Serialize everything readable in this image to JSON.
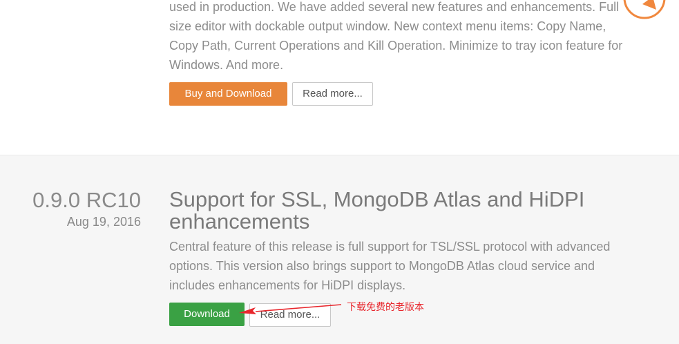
{
  "releases": [
    {
      "description": "used in production. We have added several new features and enhancements. Full size editor with dockable output window. New context menu items: Copy Name, Copy Path, Current Operations and Kill Operation. Minimize to tray icon feature for Windows. And more.",
      "primary_button": "Buy and Download",
      "secondary_button": "Read more..."
    },
    {
      "version": "0.9.0 RC10",
      "date": "Aug 19, 2016",
      "title": "Support for SSL, MongoDB Atlas and HiDPI enhancements",
      "description": "Central feature of this release is full support for TSL/SSL protocol with advanced options. This version also brings support to MongoDB Atlas cloud service and includes enhancements for HiDPI displays.",
      "primary_button": "Download",
      "secondary_button": "Read more..."
    }
  ],
  "annotation": {
    "text": "下载免费的老版本",
    "color": "#e8262c"
  },
  "colors": {
    "buy_button": "#e8863a",
    "download_button": "#3aa144",
    "logo_accent": "#f0883e"
  },
  "icons": {
    "top_right": "robomongo-logo-icon",
    "annotation_arrow": "arrow-left-icon"
  }
}
